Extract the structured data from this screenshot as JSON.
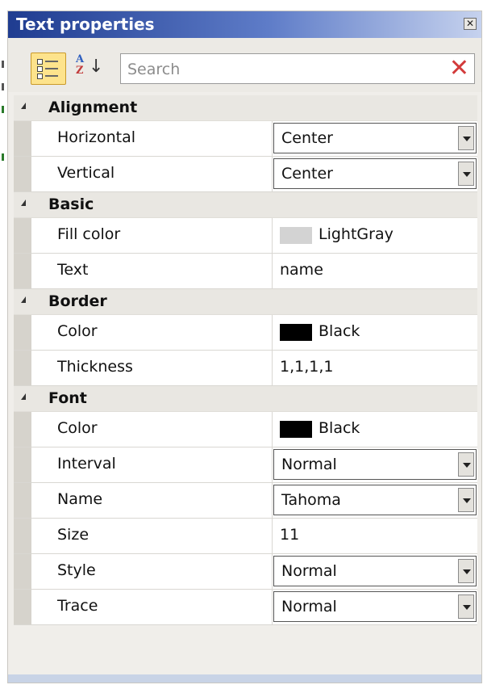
{
  "window": {
    "title": "Text properties",
    "close_icon": "close-icon"
  },
  "toolbar": {
    "categorized_icon": "categorized-icon",
    "alphabetical_icon": "sort-az-icon",
    "search_placeholder": "Search",
    "clear_icon": "clear-icon"
  },
  "categories": [
    {
      "name": "Alignment",
      "rows": [
        {
          "name": "Horizontal",
          "value": "Center",
          "type": "select"
        },
        {
          "name": "Vertical",
          "value": "Center",
          "type": "select"
        }
      ]
    },
    {
      "name": "Basic",
      "rows": [
        {
          "name": "Fill color",
          "value": "LightGray",
          "type": "color",
          "swatch": "#d3d3d3"
        },
        {
          "name": "Text",
          "value": "name",
          "type": "text"
        }
      ]
    },
    {
      "name": "Border",
      "rows": [
        {
          "name": "Color",
          "value": "Black",
          "type": "color",
          "swatch": "#000000"
        },
        {
          "name": "Thickness",
          "value": "1,1,1,1",
          "type": "text"
        }
      ]
    },
    {
      "name": "Font",
      "rows": [
        {
          "name": "Color",
          "value": "Black",
          "type": "color",
          "swatch": "#000000"
        },
        {
          "name": "Interval",
          "value": "Normal",
          "type": "select"
        },
        {
          "name": "Name",
          "value": "Tahoma",
          "type": "select"
        },
        {
          "name": "Size",
          "value": "11",
          "type": "text"
        },
        {
          "name": "Style",
          "value": "Normal",
          "type": "select"
        },
        {
          "name": "Trace",
          "value": "Normal",
          "type": "select"
        }
      ]
    }
  ]
}
